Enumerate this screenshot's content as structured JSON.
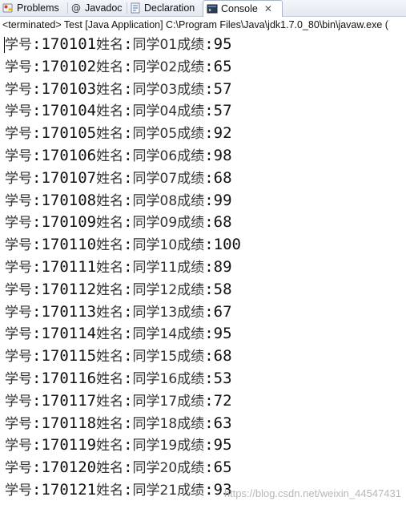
{
  "tabs": [
    {
      "label": "Problems",
      "icon": "problems-icon",
      "active": false
    },
    {
      "label": "Javadoc",
      "icon": "javadoc-icon",
      "active": false
    },
    {
      "label": "Declaration",
      "icon": "declaration-icon",
      "active": false
    },
    {
      "label": "Console",
      "icon": "console-icon",
      "active": true,
      "close": "✕"
    }
  ],
  "status_line": "<terminated> Test [Java Application] C:\\Program Files\\Java\\jdk1.7.0_80\\bin\\javaw.exe (",
  "labels": {
    "student_no": "学号",
    "name": "姓名",
    "score": "成绩",
    "colon": ":"
  },
  "records": [
    {
      "id": "170101",
      "name": "同学01",
      "score": "95"
    },
    {
      "id": "170102",
      "name": "同学02",
      "score": "65"
    },
    {
      "id": "170103",
      "name": "同学03",
      "score": "57"
    },
    {
      "id": "170104",
      "name": "同学04",
      "score": "57"
    },
    {
      "id": "170105",
      "name": "同学05",
      "score": "92"
    },
    {
      "id": "170106",
      "name": "同学06",
      "score": "98"
    },
    {
      "id": "170107",
      "name": "同学07",
      "score": "68"
    },
    {
      "id": "170108",
      "name": "同学08",
      "score": "99"
    },
    {
      "id": "170109",
      "name": "同学09",
      "score": "68"
    },
    {
      "id": "170110",
      "name": "同学10",
      "score": "100"
    },
    {
      "id": "170111",
      "name": "同学11",
      "score": "89"
    },
    {
      "id": "170112",
      "name": "同学12",
      "score": "58"
    },
    {
      "id": "170113",
      "name": "同学13",
      "score": "67"
    },
    {
      "id": "170114",
      "name": "同学14",
      "score": "95"
    },
    {
      "id": "170115",
      "name": "同学15",
      "score": "68"
    },
    {
      "id": "170116",
      "name": "同学16",
      "score": "53"
    },
    {
      "id": "170117",
      "name": "同学17",
      "score": "72"
    },
    {
      "id": "170118",
      "name": "同学18",
      "score": "63"
    },
    {
      "id": "170119",
      "name": "同学19",
      "score": "95"
    },
    {
      "id": "170120",
      "name": "同学20",
      "score": "65"
    },
    {
      "id": "170121",
      "name": "同学21",
      "score": "93"
    }
  ],
  "watermark": "https://blog.csdn.net/weixin_44547431"
}
